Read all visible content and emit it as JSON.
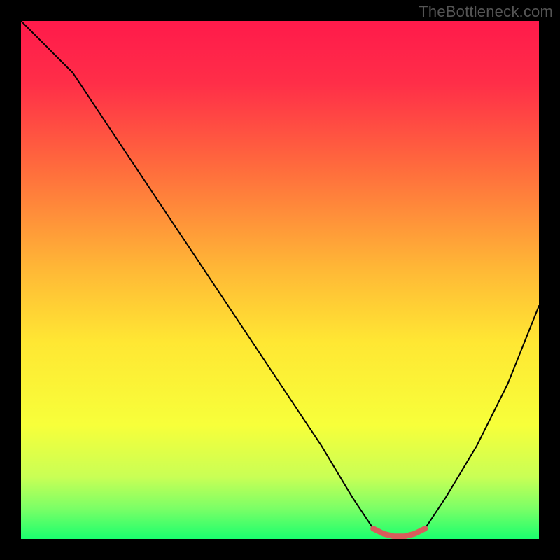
{
  "watermark": "TheBottleneck.com",
  "colors": {
    "frame": "#000000",
    "curve_main": "#000000",
    "curve_accent": "#d85b5b",
    "gradient_stops": [
      {
        "offset": 0.0,
        "color": "#ff1a4b"
      },
      {
        "offset": 0.12,
        "color": "#ff2e48"
      },
      {
        "offset": 0.28,
        "color": "#ff6a3d"
      },
      {
        "offset": 0.48,
        "color": "#ffb836"
      },
      {
        "offset": 0.62,
        "color": "#ffe733"
      },
      {
        "offset": 0.78,
        "color": "#f7ff3a"
      },
      {
        "offset": 0.88,
        "color": "#c9ff55"
      },
      {
        "offset": 0.94,
        "color": "#7dff66"
      },
      {
        "offset": 1.0,
        "color": "#1aff6e"
      }
    ]
  },
  "chart_data": {
    "type": "line",
    "title": "",
    "xlabel": "",
    "ylabel": "",
    "xlim": [
      0,
      100
    ],
    "ylim": [
      0,
      100
    ],
    "note": "x/y are percentages of the plot area; y is 0 at bottom (green), 100 at top (red). Curve minimum (~0) occurs over x≈68–78.",
    "series": [
      {
        "name": "bottleneck-curve",
        "x": [
          0,
          3,
          6,
          10,
          20,
          30,
          40,
          50,
          58,
          64,
          68,
          70,
          72,
          74,
          76,
          78,
          82,
          88,
          94,
          100
        ],
        "y": [
          100,
          97,
          94,
          90,
          75,
          60,
          45,
          30,
          18,
          8,
          2,
          1,
          0.5,
          0.5,
          1,
          2,
          8,
          18,
          30,
          45
        ]
      }
    ],
    "accent_segment": {
      "name": "red-accent-bottom",
      "x": [
        68,
        70,
        72,
        74,
        76,
        78
      ],
      "y": [
        2,
        1,
        0.5,
        0.5,
        1,
        2
      ]
    }
  }
}
